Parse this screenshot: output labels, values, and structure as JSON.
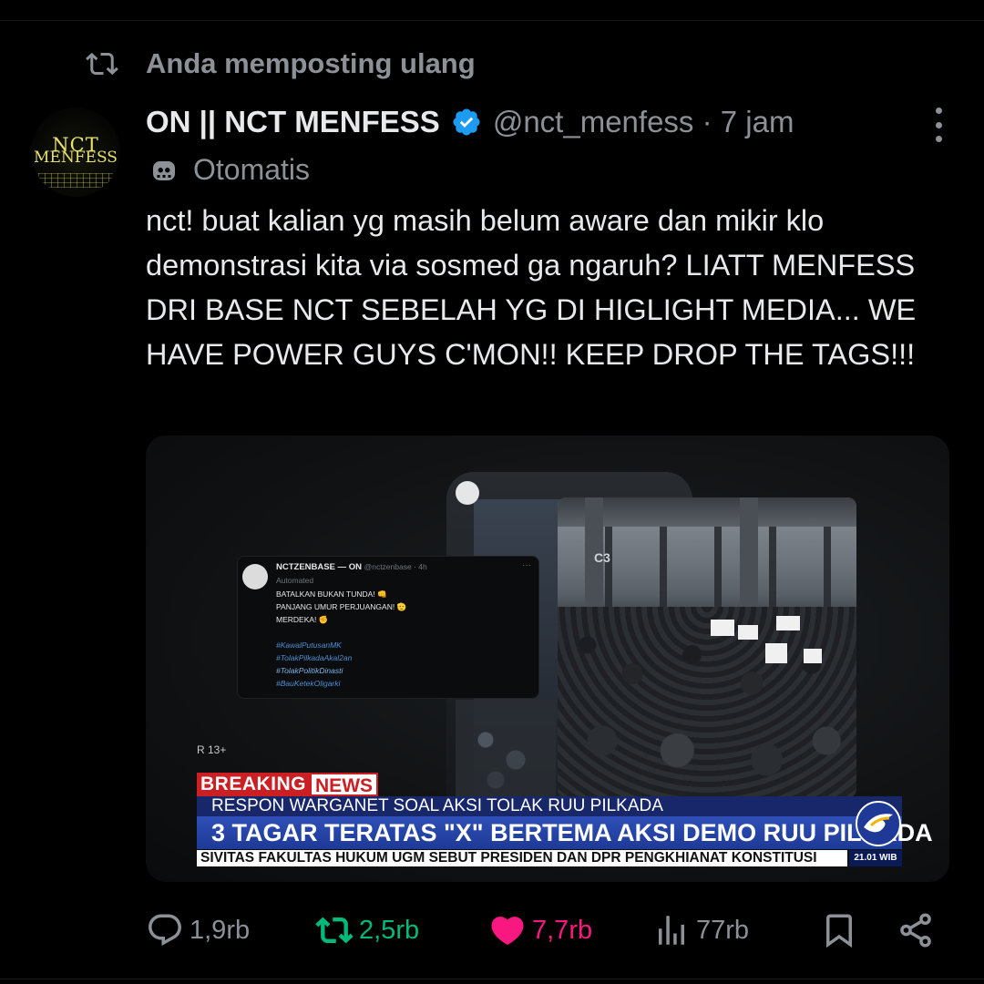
{
  "repost_banner": {
    "label": "Anda memposting ulang",
    "icon": "repost-icon"
  },
  "author": {
    "avatar_text_line1": "NCT",
    "avatar_text_line2": "MENFESS",
    "name": "ON || NCT MENFESS",
    "verified_icon": "verified-badge-icon",
    "handle_time": "@nct_menfess · 7 jam"
  },
  "automated_label": "Otomatis",
  "post_text": "nct! buat kalian yg masih belum aware dan mikir klo demonstrasi kita via sosmed ga ngaruh? LIATT MENFESS DRI BASE NCT SEBELAH YG DI HIGLIGHT MEDIA... WE HAVE POWER GUYS C'MON!! KEEP DROP THE TAGS!!!",
  "media": {
    "embedded_tweet": {
      "name": "NCTZENBASE — ON",
      "handle_time": "@nctzenbase · 4h",
      "automated": "Automated",
      "line1": "BATALKAN BUKAN TUNDA! 👊",
      "line2": "PANJANG UMUR PERJUANGAN! 🫡",
      "line3": "MERDEKA! ✊",
      "tags": [
        "#KawalPutusanMK",
        "#TolakPilkadaAkal2an",
        "#TolakPolitikDinasti",
        "#BauKetekOligarki"
      ]
    },
    "rating": "R 13+",
    "pillar_label": "C3",
    "breaking_1": "BREAKING",
    "breaking_2": "NEWS",
    "ticker_top": "RESPON WARGANET SOAL AKSI TOLAK RUU PILKADA",
    "ticker_main": "3 TAGAR TERATAS  \"X\" BERTEMA AKSI DEMO RUU PILKADA",
    "ticker_bottom": "SIVITAS FAKULTAS HUKUM UGM SEBUT PRESIDEN DAN DPR PENGKHIANAT KONSTITUSI",
    "clock": "21.01 WIB"
  },
  "actions": {
    "reply": "1,9rb",
    "repost": "2,5rb",
    "like": "7,7rb",
    "views": "77rb"
  },
  "colors": {
    "background": "#000000",
    "secondary_text": "#8b9197",
    "verified": "#1d9bf0",
    "repost_active": "#00ba7c",
    "like_active": "#f91880"
  }
}
